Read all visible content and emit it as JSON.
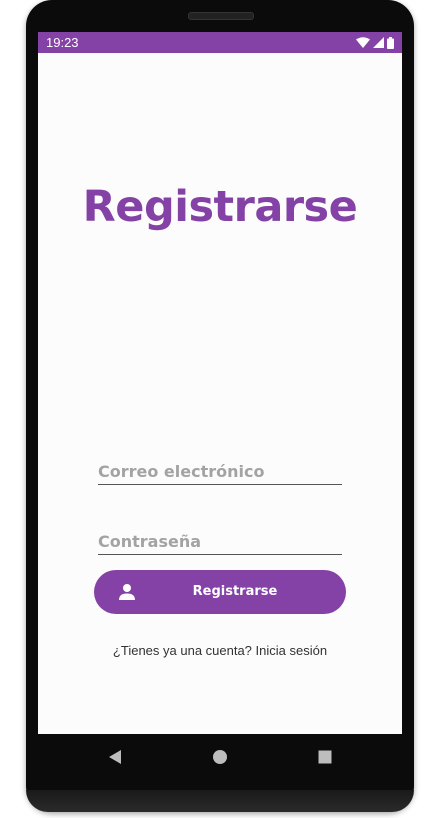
{
  "status_bar": {
    "time": "19:23",
    "icons": [
      "wifi-icon",
      "signal-icon",
      "battery-icon"
    ],
    "color": "#8442a6"
  },
  "page": {
    "title": "Registrarse"
  },
  "form": {
    "email_placeholder": "Correo electrónico",
    "email_value": "",
    "password_placeholder": "Contraseña",
    "password_value": "",
    "submit_label": "Registrarse",
    "submit_icon": "person-icon"
  },
  "footer": {
    "login_link": "¿Tienes ya una cuenta? Inicia sesión"
  },
  "nav": {
    "buttons": [
      "back-icon",
      "home-icon",
      "recents-icon"
    ]
  },
  "colors": {
    "accent": "#8442a6",
    "screen_bg": "#fdfcfd"
  }
}
